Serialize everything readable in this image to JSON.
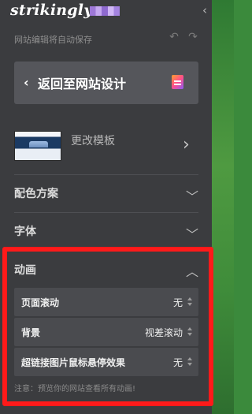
{
  "brand": {
    "logo_text": "strikingly"
  },
  "header": {
    "collapse_icon": "chevron-left-icon",
    "autosave_text": "网站编辑将自动保存",
    "undo_icon": "undo-icon",
    "redo_icon": "redo-icon"
  },
  "back_button": {
    "label": "返回至网站设计",
    "chevron_icon": "chevron-left-icon",
    "badge_icon": "document-icon"
  },
  "template": {
    "label": "更改模板",
    "chevron_icon": "chevron-right-icon"
  },
  "sections": [
    {
      "title": "配色方案",
      "state": "collapsed",
      "icon": "chevron-down-icon"
    },
    {
      "title": "字体",
      "state": "collapsed",
      "icon": "chevron-down-icon"
    }
  ],
  "animation": {
    "title": "动画",
    "state": "expanded",
    "icon": "chevron-up-icon",
    "settings": [
      {
        "label": "页面滚动",
        "value": "无"
      },
      {
        "label": "背景",
        "value": "视差滚动"
      },
      {
        "label": "超链接图片鼠标悬停效果",
        "value": "无"
      }
    ],
    "note": "注意：预览你的网站查看所有动画!"
  },
  "colors": {
    "panel_bg": "#3b3c3f",
    "highlight_border": "#ff1a1a",
    "preview_bg": "#3b8a3c"
  }
}
